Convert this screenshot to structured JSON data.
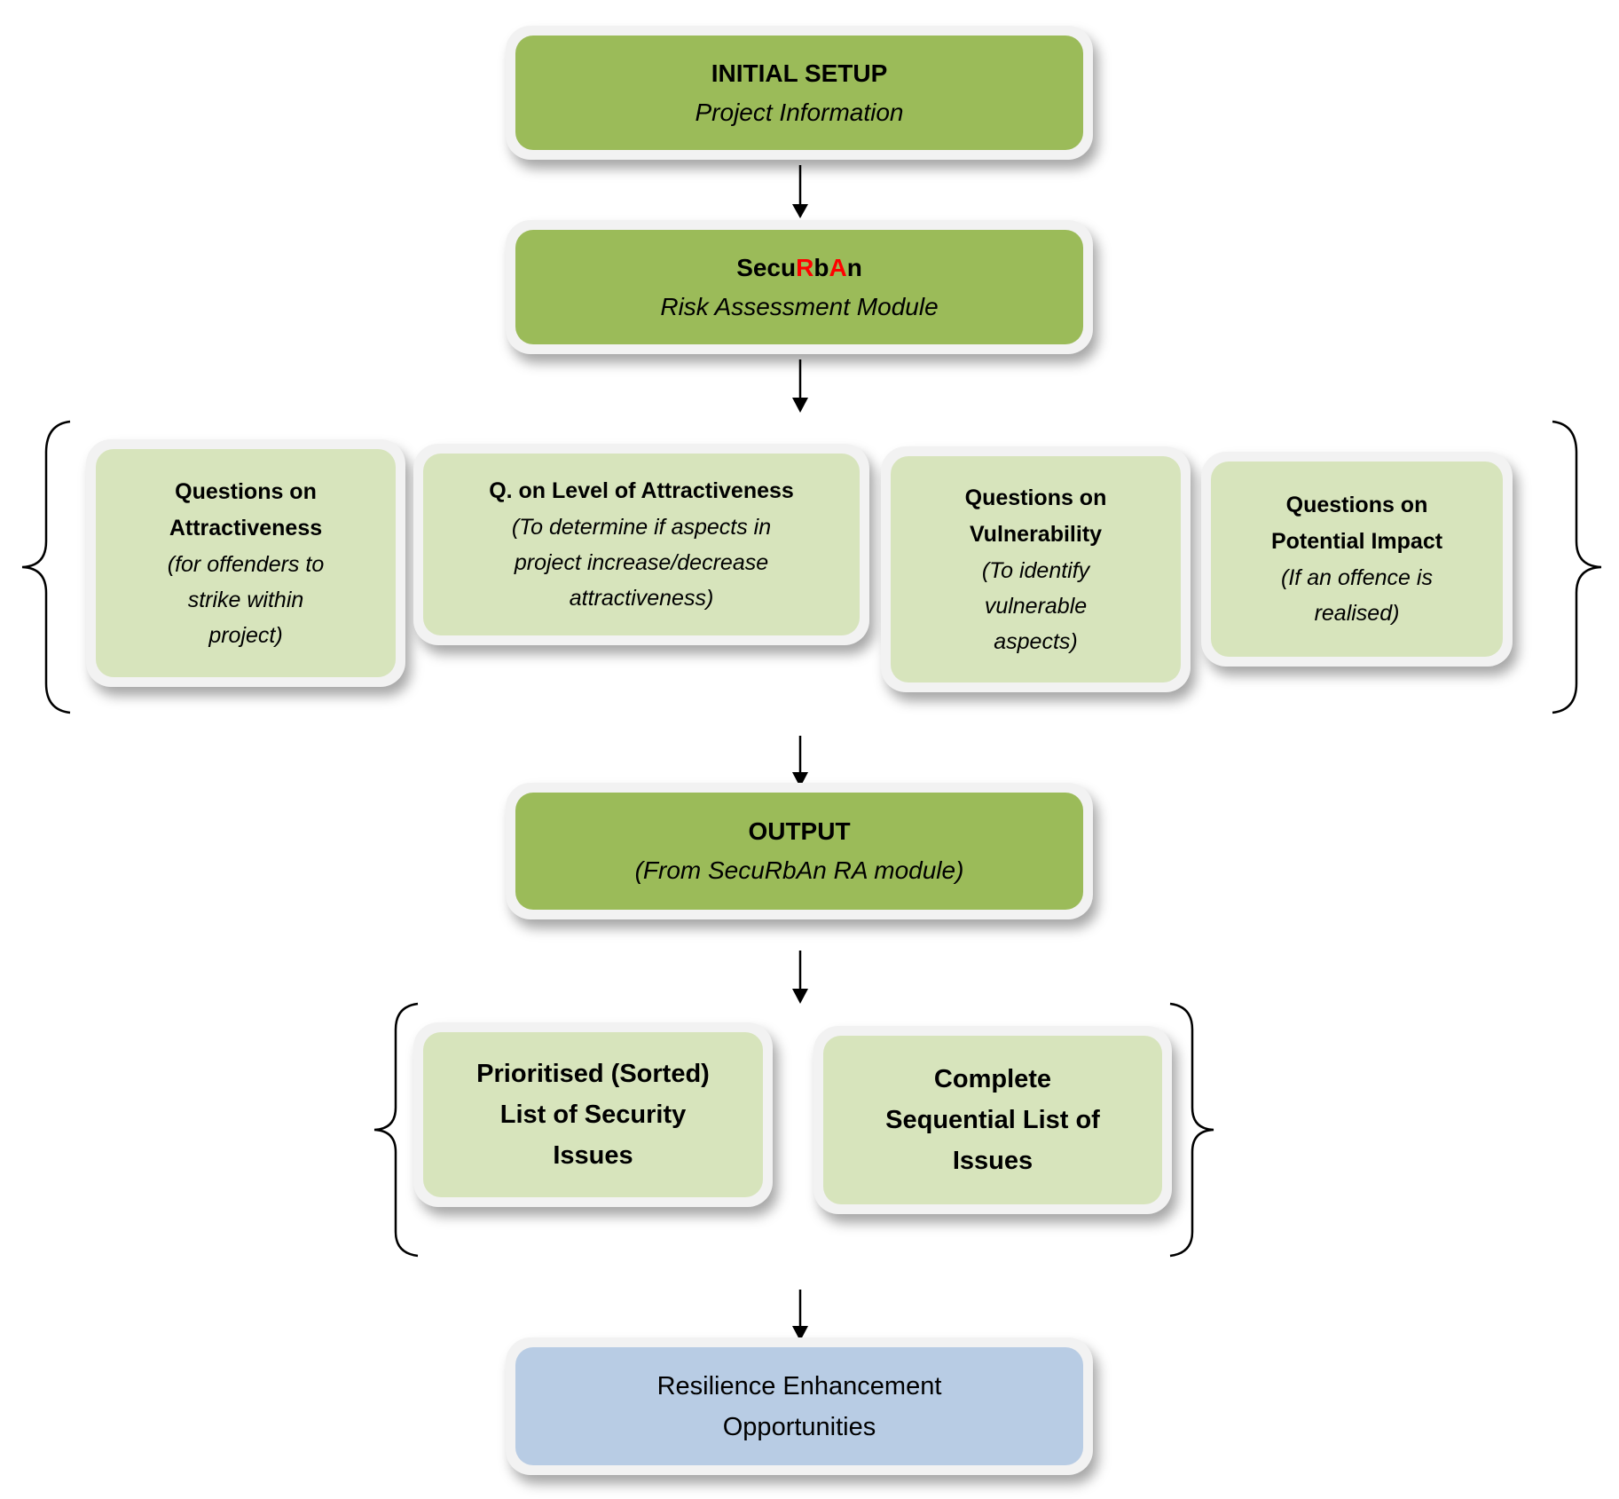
{
  "colors": {
    "primary_box": "#9bbb59",
    "secondary_box": "#d7e4bc",
    "final_box": "#b8cce4",
    "highlight": "#ff0000"
  },
  "initial_setup": {
    "title": "INITIAL SETUP",
    "subtitle": "Project Information"
  },
  "module": {
    "title_parts": [
      "Secu",
      "R",
      "b",
      "A",
      "n"
    ],
    "subtitle": "Risk Assessment  Module"
  },
  "questions": [
    {
      "title": [
        "Questions on",
        "Attractiveness"
      ],
      "subtitle": [
        "(for offenders to",
        "strike within",
        "project)"
      ]
    },
    {
      "title": [
        "Q. on Level of Attractiveness"
      ],
      "subtitle": [
        "(To determine if aspects in",
        "project increase/decrease",
        "attractiveness)"
      ]
    },
    {
      "title": [
        "Questions on",
        "Vulnerability"
      ],
      "subtitle": [
        "(To identify",
        "vulnerable",
        "aspects)"
      ]
    },
    {
      "title": [
        "Questions on",
        "Potential Impact"
      ],
      "subtitle": [
        "(If an offence is",
        "realised)"
      ]
    }
  ],
  "output": {
    "title": "OUTPUT",
    "subtitle": "(From SecuRbAn RA module)"
  },
  "lists": [
    {
      "lines": [
        "Prioritised (Sorted)",
        "List of Security",
        "Issues"
      ]
    },
    {
      "lines": [
        "Complete",
        "Sequential List of",
        "Issues"
      ]
    }
  ],
  "final": {
    "lines": [
      "Resilience Enhancement",
      "Opportunities"
    ]
  }
}
